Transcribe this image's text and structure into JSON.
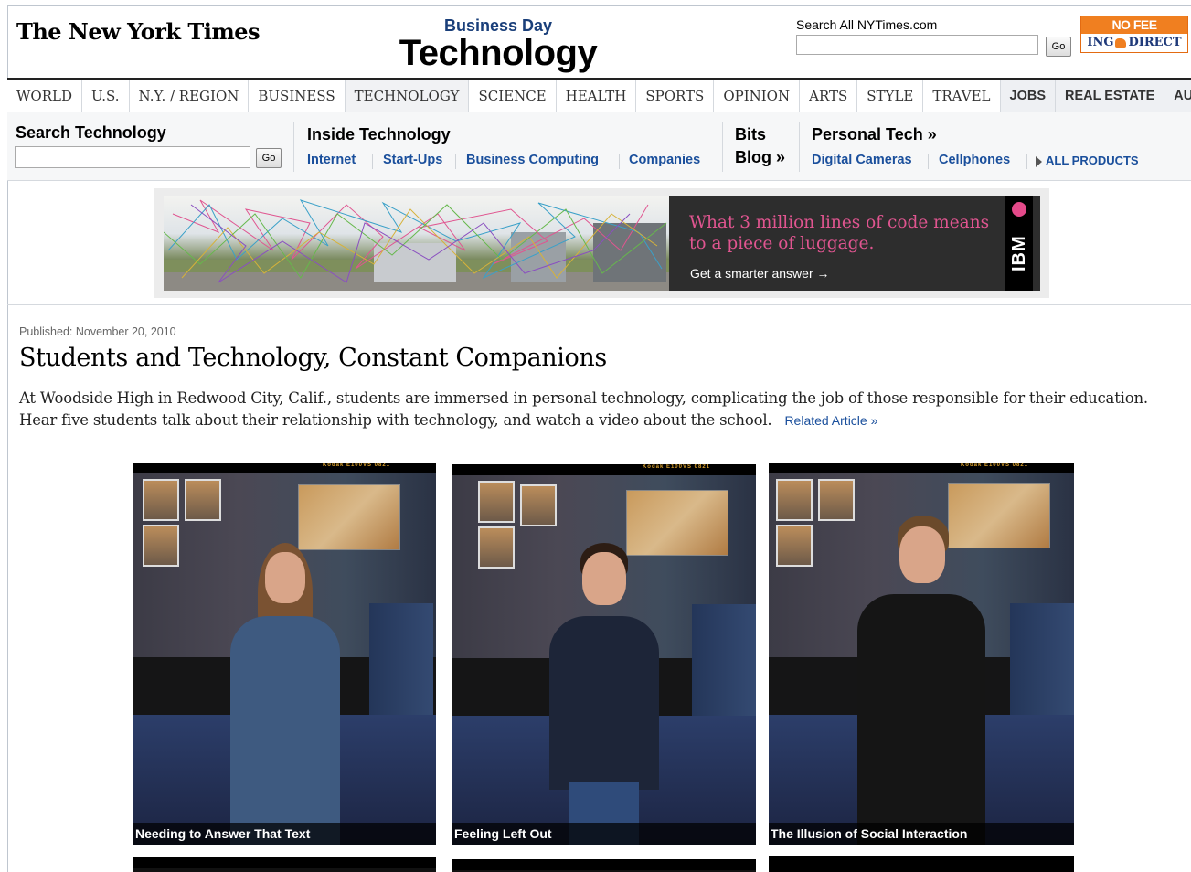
{
  "masthead": {
    "logo": "The New York Times",
    "section_kicker": "Business Day",
    "section_title": "Technology",
    "search_label": "Search All NYTimes.com",
    "search_go": "Go",
    "ing_ad": {
      "top": "NO FEE CHECKING",
      "bottom_left": "ING",
      "bottom_right": "DIRECT"
    }
  },
  "main_nav": [
    {
      "label": "WORLD"
    },
    {
      "label": "U.S."
    },
    {
      "label": "N.Y. / REGION"
    },
    {
      "label": "BUSINESS"
    },
    {
      "label": "TECHNOLOGY"
    },
    {
      "label": "SCIENCE"
    },
    {
      "label": "HEALTH"
    },
    {
      "label": "SPORTS"
    },
    {
      "label": "OPINION"
    },
    {
      "label": "ARTS"
    },
    {
      "label": "STYLE"
    },
    {
      "label": "TRAVEL"
    },
    {
      "label": "JOBS"
    },
    {
      "label": "REAL ESTATE"
    },
    {
      "label": "AUTOS"
    }
  ],
  "sub_nav": {
    "search_heading": "Search Technology",
    "search_go": "Go",
    "inside_heading": "Inside Technology",
    "inside_links": [
      "Internet",
      "Start-Ups",
      "Business Computing",
      "Companies"
    ],
    "bits_heading_line1": "Bits",
    "bits_heading_line2": "Blog »",
    "personal_heading": "Personal Tech »",
    "personal_links": [
      "Digital Cameras",
      "Cellphones"
    ],
    "all_products": "ALL PRODUCTS"
  },
  "ad": {
    "headline": "What 3 million lines of code means to a piece of luggage.",
    "cta": "Get a smarter answer →",
    "brand": "IBM"
  },
  "article": {
    "published": "Published: November 20, 2010",
    "title": "Students and Technology, Constant Companions",
    "summary": "At Woodside High in Redwood City, Calif., students are immersed in personal technology, complicating the job of those responsible for their education. Hear five students talk about their relationship with technology, and watch a video about the school.",
    "related_link": "Related Article »"
  },
  "photos": [
    {
      "caption": "Needing to Answer That Text",
      "film": "Kodak E100VS 0821"
    },
    {
      "caption": "Feeling Left Out",
      "film": "Kodak E100VS 0821"
    },
    {
      "caption": "The Illusion of Social Interaction",
      "film": "Kodak E100VS 0821"
    }
  ]
}
